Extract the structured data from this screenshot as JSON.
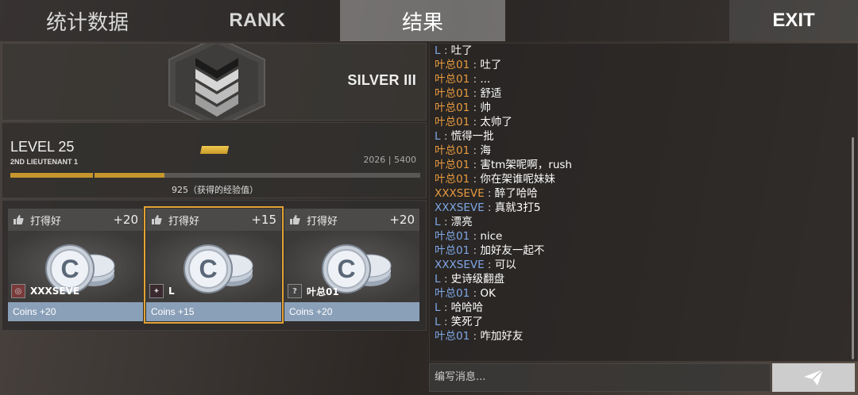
{
  "nav": {
    "stats": "统计数据",
    "rank": "RANK",
    "result": "结果",
    "exit": "EXIT"
  },
  "rank": {
    "title": "SILVER III"
  },
  "level": {
    "title": "LEVEL 25",
    "subtitle": "2ND LIEUTENANT 1",
    "xp_current": "2026 | 5400",
    "xp_gained_label": "925（获得的经验值）",
    "progress_fraction": 0.375
  },
  "cards": [
    {
      "label": "打得好",
      "points": "+20",
      "player": "XXXSEVE",
      "coins": "Coins +20"
    },
    {
      "label": "打得好",
      "points": "+15",
      "player": "L",
      "coins": "Coins +15"
    },
    {
      "label": "打得好",
      "points": "+20",
      "player": "叶总01",
      "coins": "Coins +20"
    }
  ],
  "chat": {
    "messages": [
      {
        "name": "L",
        "text": "吐了",
        "color": "L"
      },
      {
        "name": "叶总01",
        "text": "吐了",
        "color": "orange"
      },
      {
        "name": "叶总01",
        "text": "...",
        "color": "orange"
      },
      {
        "name": "叶总01",
        "text": "舒适",
        "color": "orange"
      },
      {
        "name": "叶总01",
        "text": "帅",
        "color": "orange"
      },
      {
        "name": "叶总01",
        "text": "太帅了",
        "color": "orange"
      },
      {
        "name": "L",
        "text": "慌得一批",
        "color": "L"
      },
      {
        "name": "叶总01",
        "text": " 海",
        "color": "orange"
      },
      {
        "name": "叶总01",
        "text": "害tm架呢啊，rush",
        "color": "orange"
      },
      {
        "name": "叶总01",
        "text": "你在架谁呢妹妹",
        "color": "orange"
      },
      {
        "name": "XXXSEVE",
        "text": "醉了哈哈",
        "color": "orange"
      },
      {
        "name": "XXXSEVE",
        "text": "真就3打5",
        "color": "blue"
      },
      {
        "name": "L",
        "text": "漂亮",
        "color": "L"
      },
      {
        "name": "叶总01",
        "text": "nice",
        "color": "blue"
      },
      {
        "name": "叶总01",
        "text": "加好友一起不",
        "color": "blue"
      },
      {
        "name": "XXXSEVE",
        "text": "可以",
        "color": "blue"
      },
      {
        "name": "L",
        "text": "史诗级翻盘",
        "color": "L"
      },
      {
        "name": "叶总01",
        "text": "OK",
        "color": "blue"
      },
      {
        "name": "L",
        "text": "哈哈哈",
        "color": "L"
      },
      {
        "name": "L",
        "text": "笑死了",
        "color": "L"
      },
      {
        "name": "叶总01",
        "text": "咋加好友",
        "color": "blue"
      }
    ],
    "input_placeholder": "编写消息..."
  },
  "colors": {
    "accent_gold": "#c6952c",
    "selected_outline": "#e3a234",
    "coins_bar": "#8aa0b8"
  }
}
